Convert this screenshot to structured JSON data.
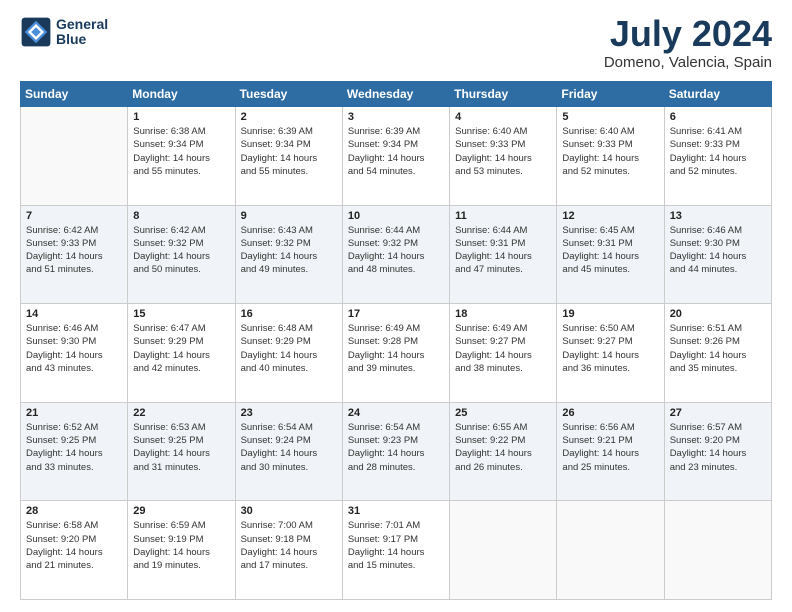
{
  "header": {
    "logo_line1": "General",
    "logo_line2": "Blue",
    "month": "July 2024",
    "location": "Domeno, Valencia, Spain"
  },
  "weekdays": [
    "Sunday",
    "Monday",
    "Tuesday",
    "Wednesday",
    "Thursday",
    "Friday",
    "Saturday"
  ],
  "weeks": [
    [
      {
        "day": "",
        "info": ""
      },
      {
        "day": "1",
        "info": "Sunrise: 6:38 AM\nSunset: 9:34 PM\nDaylight: 14 hours\nand 55 minutes."
      },
      {
        "day": "2",
        "info": "Sunrise: 6:39 AM\nSunset: 9:34 PM\nDaylight: 14 hours\nand 55 minutes."
      },
      {
        "day": "3",
        "info": "Sunrise: 6:39 AM\nSunset: 9:34 PM\nDaylight: 14 hours\nand 54 minutes."
      },
      {
        "day": "4",
        "info": "Sunrise: 6:40 AM\nSunset: 9:33 PM\nDaylight: 14 hours\nand 53 minutes."
      },
      {
        "day": "5",
        "info": "Sunrise: 6:40 AM\nSunset: 9:33 PM\nDaylight: 14 hours\nand 52 minutes."
      },
      {
        "day": "6",
        "info": "Sunrise: 6:41 AM\nSunset: 9:33 PM\nDaylight: 14 hours\nand 52 minutes."
      }
    ],
    [
      {
        "day": "7",
        "info": "Sunrise: 6:42 AM\nSunset: 9:33 PM\nDaylight: 14 hours\nand 51 minutes."
      },
      {
        "day": "8",
        "info": "Sunrise: 6:42 AM\nSunset: 9:32 PM\nDaylight: 14 hours\nand 50 minutes."
      },
      {
        "day": "9",
        "info": "Sunrise: 6:43 AM\nSunset: 9:32 PM\nDaylight: 14 hours\nand 49 minutes."
      },
      {
        "day": "10",
        "info": "Sunrise: 6:44 AM\nSunset: 9:32 PM\nDaylight: 14 hours\nand 48 minutes."
      },
      {
        "day": "11",
        "info": "Sunrise: 6:44 AM\nSunset: 9:31 PM\nDaylight: 14 hours\nand 47 minutes."
      },
      {
        "day": "12",
        "info": "Sunrise: 6:45 AM\nSunset: 9:31 PM\nDaylight: 14 hours\nand 45 minutes."
      },
      {
        "day": "13",
        "info": "Sunrise: 6:46 AM\nSunset: 9:30 PM\nDaylight: 14 hours\nand 44 minutes."
      }
    ],
    [
      {
        "day": "14",
        "info": "Sunrise: 6:46 AM\nSunset: 9:30 PM\nDaylight: 14 hours\nand 43 minutes."
      },
      {
        "day": "15",
        "info": "Sunrise: 6:47 AM\nSunset: 9:29 PM\nDaylight: 14 hours\nand 42 minutes."
      },
      {
        "day": "16",
        "info": "Sunrise: 6:48 AM\nSunset: 9:29 PM\nDaylight: 14 hours\nand 40 minutes."
      },
      {
        "day": "17",
        "info": "Sunrise: 6:49 AM\nSunset: 9:28 PM\nDaylight: 14 hours\nand 39 minutes."
      },
      {
        "day": "18",
        "info": "Sunrise: 6:49 AM\nSunset: 9:27 PM\nDaylight: 14 hours\nand 38 minutes."
      },
      {
        "day": "19",
        "info": "Sunrise: 6:50 AM\nSunset: 9:27 PM\nDaylight: 14 hours\nand 36 minutes."
      },
      {
        "day": "20",
        "info": "Sunrise: 6:51 AM\nSunset: 9:26 PM\nDaylight: 14 hours\nand 35 minutes."
      }
    ],
    [
      {
        "day": "21",
        "info": "Sunrise: 6:52 AM\nSunset: 9:25 PM\nDaylight: 14 hours\nand 33 minutes."
      },
      {
        "day": "22",
        "info": "Sunrise: 6:53 AM\nSunset: 9:25 PM\nDaylight: 14 hours\nand 31 minutes."
      },
      {
        "day": "23",
        "info": "Sunrise: 6:54 AM\nSunset: 9:24 PM\nDaylight: 14 hours\nand 30 minutes."
      },
      {
        "day": "24",
        "info": "Sunrise: 6:54 AM\nSunset: 9:23 PM\nDaylight: 14 hours\nand 28 minutes."
      },
      {
        "day": "25",
        "info": "Sunrise: 6:55 AM\nSunset: 9:22 PM\nDaylight: 14 hours\nand 26 minutes."
      },
      {
        "day": "26",
        "info": "Sunrise: 6:56 AM\nSunset: 9:21 PM\nDaylight: 14 hours\nand 25 minutes."
      },
      {
        "day": "27",
        "info": "Sunrise: 6:57 AM\nSunset: 9:20 PM\nDaylight: 14 hours\nand 23 minutes."
      }
    ],
    [
      {
        "day": "28",
        "info": "Sunrise: 6:58 AM\nSunset: 9:20 PM\nDaylight: 14 hours\nand 21 minutes."
      },
      {
        "day": "29",
        "info": "Sunrise: 6:59 AM\nSunset: 9:19 PM\nDaylight: 14 hours\nand 19 minutes."
      },
      {
        "day": "30",
        "info": "Sunrise: 7:00 AM\nSunset: 9:18 PM\nDaylight: 14 hours\nand 17 minutes."
      },
      {
        "day": "31",
        "info": "Sunrise: 7:01 AM\nSunset: 9:17 PM\nDaylight: 14 hours\nand 15 minutes."
      },
      {
        "day": "",
        "info": ""
      },
      {
        "day": "",
        "info": ""
      },
      {
        "day": "",
        "info": ""
      }
    ]
  ]
}
